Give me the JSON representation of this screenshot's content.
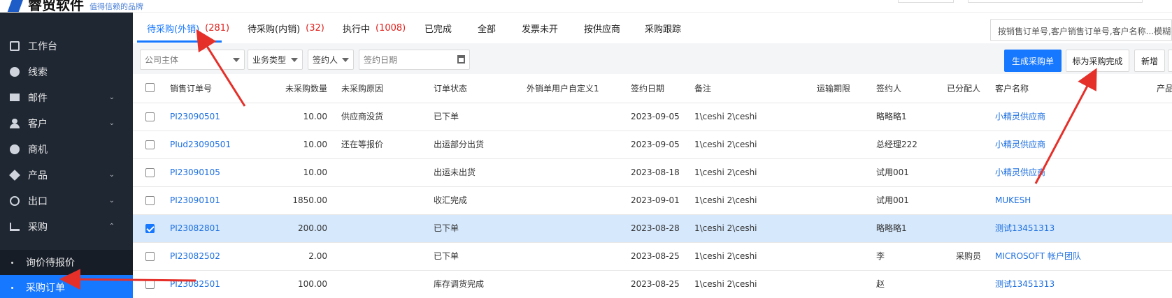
{
  "header": {
    "logo_text": "睿贸软件",
    "logo_subtitle": "值得信赖的品牌"
  },
  "sidebar": {
    "items": [
      {
        "label": "工作台",
        "icon": "dashboard-icon"
      },
      {
        "label": "线索",
        "icon": "clue-icon"
      },
      {
        "label": "邮件",
        "icon": "mail-icon"
      },
      {
        "label": "客户",
        "icon": "customer-icon"
      },
      {
        "label": "商机",
        "icon": "dollar-icon"
      },
      {
        "label": "产品",
        "icon": "product-icon"
      },
      {
        "label": "出口",
        "icon": "globe-icon"
      },
      {
        "label": "采购",
        "icon": "cart-icon"
      }
    ],
    "sub_items": [
      {
        "label": "询价待报价"
      },
      {
        "label": "采购订单",
        "active": true
      }
    ]
  },
  "tabs": [
    {
      "label": "待采购(外销)",
      "count": "(281)",
      "active": true
    },
    {
      "label": "待采购(内销)",
      "count": "(32)"
    },
    {
      "label": "执行中",
      "count": "(1008)"
    },
    {
      "label": "已完成",
      "count": ""
    },
    {
      "label": "全部",
      "count": ""
    },
    {
      "label": "发票未开",
      "count": ""
    },
    {
      "label": "按供应商",
      "count": ""
    },
    {
      "label": "采购跟踪",
      "count": ""
    }
  ],
  "search": {
    "placeholder": "按销售订单号,客户销售订单号,客户名称...模糊搜索"
  },
  "filters": {
    "company": "公司主体",
    "business_type": "业务类型",
    "signer": "签约人",
    "sign_date": "签约日期"
  },
  "actions": {
    "generate": "生成采购单",
    "mark_complete": "标为采购完成",
    "add": "新增"
  },
  "table": {
    "columns": [
      "销售订单号",
      "未采购数量",
      "未采购原因",
      "订单状态",
      "外销单用户自定义1",
      "签约日期",
      "备注",
      "运输期限",
      "签约人",
      "已分配人",
      "客户名称",
      "产品"
    ],
    "rows": [
      {
        "order": "PI23090501",
        "qty": "10.00",
        "reason": "供应商没货",
        "status": "已下单",
        "custom1": "",
        "date": "2023-09-05",
        "note": "1\\ceshi 2\\ceshi",
        "transport": "",
        "signer": "略略略1",
        "assigned": "",
        "customer": "小精灵供应商",
        "checked": false
      },
      {
        "order": "PIud23090501",
        "qty": "10.00",
        "reason": "还在等报价",
        "status": "出运部分出货",
        "custom1": "",
        "date": "2023-09-05",
        "note": "1\\ceshi 2\\ceshi",
        "transport": "",
        "signer": "总经理222",
        "assigned": "",
        "customer": "小精灵供应商",
        "checked": false
      },
      {
        "order": "PI23090105",
        "qty": "10.00",
        "reason": "",
        "status": "出运未出货",
        "custom1": "",
        "date": "2023-08-18",
        "note": "1\\ceshi 2\\ceshi",
        "transport": "",
        "signer": "试用001",
        "assigned": "",
        "customer": "小精灵供应商",
        "checked": false
      },
      {
        "order": "PI23090101",
        "qty": "1850.00",
        "reason": "",
        "status": "收汇完成",
        "custom1": "",
        "date": "2023-09-01",
        "note": "1\\ceshi 2\\ceshi",
        "transport": "",
        "signer": "试用001",
        "assigned": "",
        "customer": "MUKESH",
        "checked": false
      },
      {
        "order": "PI23082801",
        "qty": "200.00",
        "reason": "",
        "status": "已下单",
        "custom1": "",
        "date": "2023-08-28",
        "note": "1\\ceshi 2\\ceshi",
        "transport": "",
        "signer": "略略略1",
        "assigned": "",
        "customer": "测试13451313",
        "checked": true
      },
      {
        "order": "PI23082502",
        "qty": "2.00",
        "reason": "",
        "status": "已下单",
        "custom1": "",
        "date": "2023-08-25",
        "note": "1\\ceshi 2\\ceshi",
        "transport": "",
        "signer": "李",
        "assigned": "采购员",
        "customer": "MICROSOFT 帐户团队",
        "checked": false
      },
      {
        "order": "PI23082501",
        "qty": "100.00",
        "reason": "",
        "status": "库存调货完成",
        "custom1": "",
        "date": "2023-08-25",
        "note": "1\\ceshi 2\\ceshi",
        "transport": "",
        "signer": "赵",
        "assigned": "",
        "customer": "测试13451313",
        "checked": false
      }
    ]
  },
  "colors": {
    "accent": "#1677ff",
    "sidebar_bg": "#1f2733",
    "count_red": "#e0201b",
    "arrow_red": "#e5302a"
  }
}
